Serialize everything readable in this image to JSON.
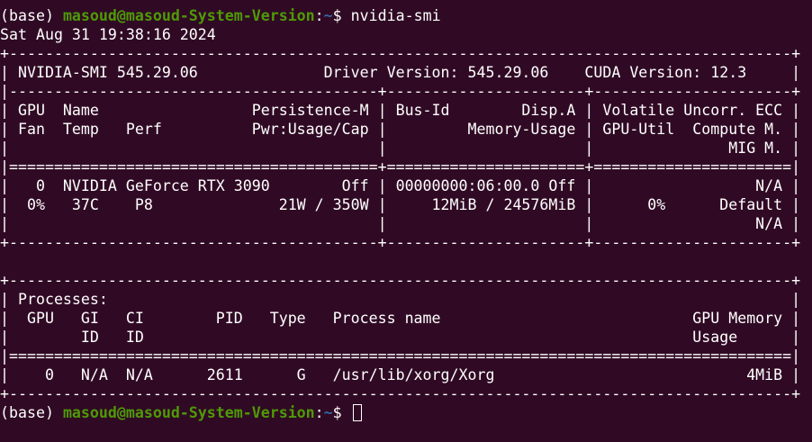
{
  "prompt": {
    "env": "(base) ",
    "user_host": "masoud@masoud-System-Version",
    "separator": ":",
    "path": "~",
    "symbol": "$ "
  },
  "command": "nvidia-smi",
  "output_lines": [
    "Sat Aug 31 19:38:16 2024       ",
    "+---------------------------------------------------------------------------------------+",
    "| NVIDIA-SMI 545.29.06              Driver Version: 545.29.06    CUDA Version: 12.3     |",
    "|-----------------------------------------+----------------------+----------------------+",
    "| GPU  Name                 Persistence-M | Bus-Id        Disp.A | Volatile Uncorr. ECC |",
    "| Fan  Temp   Perf          Pwr:Usage/Cap |         Memory-Usage | GPU-Util  Compute M. |",
    "|                                         |                      |               MIG M. |",
    "|=========================================+======================+======================|",
    "|   0  NVIDIA GeForce RTX 3090        Off | 00000000:06:00.0 Off |                  N/A |",
    "|  0%   37C    P8              21W / 350W |     12MiB / 24576MiB |      0%      Default |",
    "|                                         |                      |                  N/A |",
    "+-----------------------------------------+----------------------+----------------------+",
    "                                                                                         ",
    "+---------------------------------------------------------------------------------------+",
    "| Processes:                                                                            |",
    "|  GPU   GI   CI        PID   Type   Process name                            GPU Memory |",
    "|        ID   ID                                                             Usage      |",
    "|=======================================================================================|",
    "|    0   N/A  N/A      2611      G   /usr/lib/xorg/Xorg                            4MiB |",
    "+---------------------------------------------------------------------------------------+"
  ],
  "final_prompt": {
    "env": "(base) ",
    "user_host": "masoud@masoud-System-Version",
    "separator": ":",
    "path": "~",
    "symbol": "$ "
  },
  "colors": {
    "background": "#300a24",
    "text": "#ffffff",
    "user_host": "#4e9a06",
    "path": "#3465a4"
  }
}
